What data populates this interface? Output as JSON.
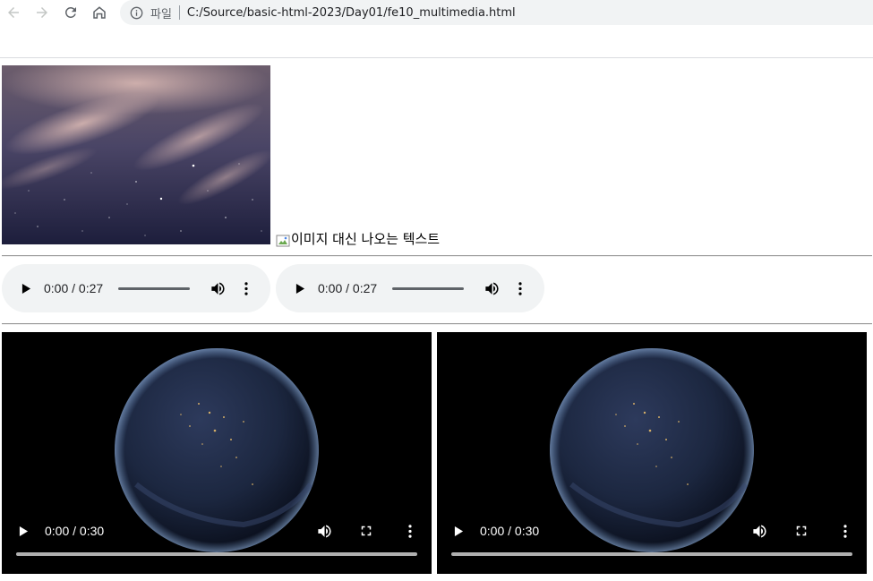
{
  "browser": {
    "scheme_label": "파일",
    "url": "C:/Source/basic-html-2023/Day01/fe10_multimedia.html",
    "icons": {
      "back": "arrow-left-icon",
      "forward": "arrow-right-icon",
      "reload": "reload-icon",
      "home": "home-icon",
      "info": "info-icon"
    }
  },
  "page": {
    "image_alt_text": "이미지 대신 나오는 텍스트",
    "audios": [
      {
        "time": "0:00 / 0:27"
      },
      {
        "time": "0:00 / 0:27"
      }
    ],
    "videos": [
      {
        "time": "0:00 / 0:30"
      },
      {
        "time": "0:00 / 0:30"
      }
    ]
  }
}
